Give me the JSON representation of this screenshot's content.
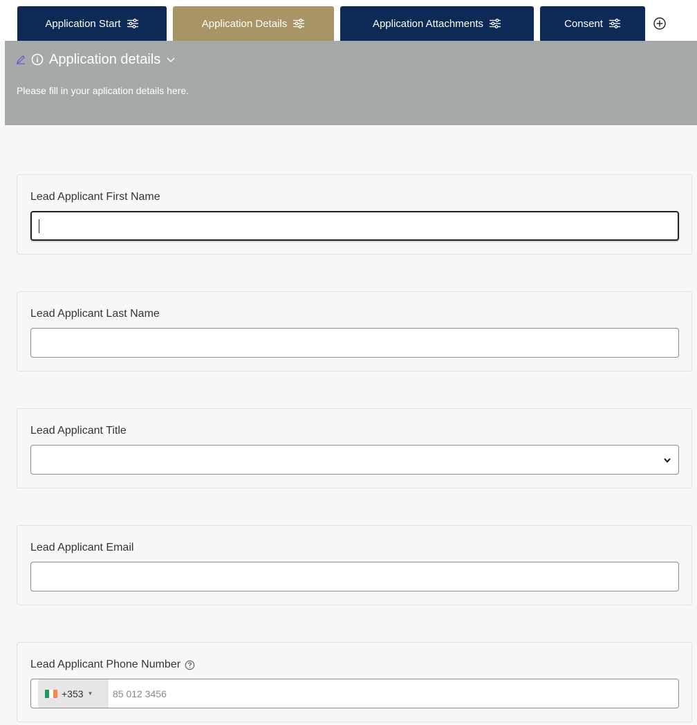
{
  "tabs": [
    {
      "label": "Application Start",
      "active": false
    },
    {
      "label": "Application Details",
      "active": true
    },
    {
      "label": "Application Attachments",
      "active": false
    },
    {
      "label": "Consent",
      "active": false
    }
  ],
  "section": {
    "title": "Application details",
    "description": "Please fill in your aplication details here."
  },
  "fields": {
    "first_name": {
      "label": "Lead Applicant First Name",
      "value": ""
    },
    "last_name": {
      "label": "Lead Applicant Last Name",
      "value": ""
    },
    "title": {
      "label": "Lead Applicant Title",
      "selected": ""
    },
    "email": {
      "label": "Lead Applicant Email",
      "value": ""
    },
    "phone": {
      "label": "Lead Applicant Phone Number",
      "country_code": "+353",
      "placeholder": "85 012 3456"
    }
  },
  "colors": {
    "tab_bg": "#0d2a57",
    "tab_active_bg": "#a89465",
    "header_bg": "#a5a9aa",
    "flag_green": "#169b62",
    "flag_white": "#ffffff",
    "flag_orange": "#ff883e",
    "edit_icon": "#5b5bd6"
  },
  "icons": {
    "tab_settings": "sliders-icon",
    "add_tab": "plus-circle-icon",
    "edit": "pencil-icon",
    "info": "info-icon",
    "collapse": "chevron-down-icon",
    "select": "chevron-down-icon",
    "help": "help-icon",
    "flag": "ireland-flag-icon"
  }
}
